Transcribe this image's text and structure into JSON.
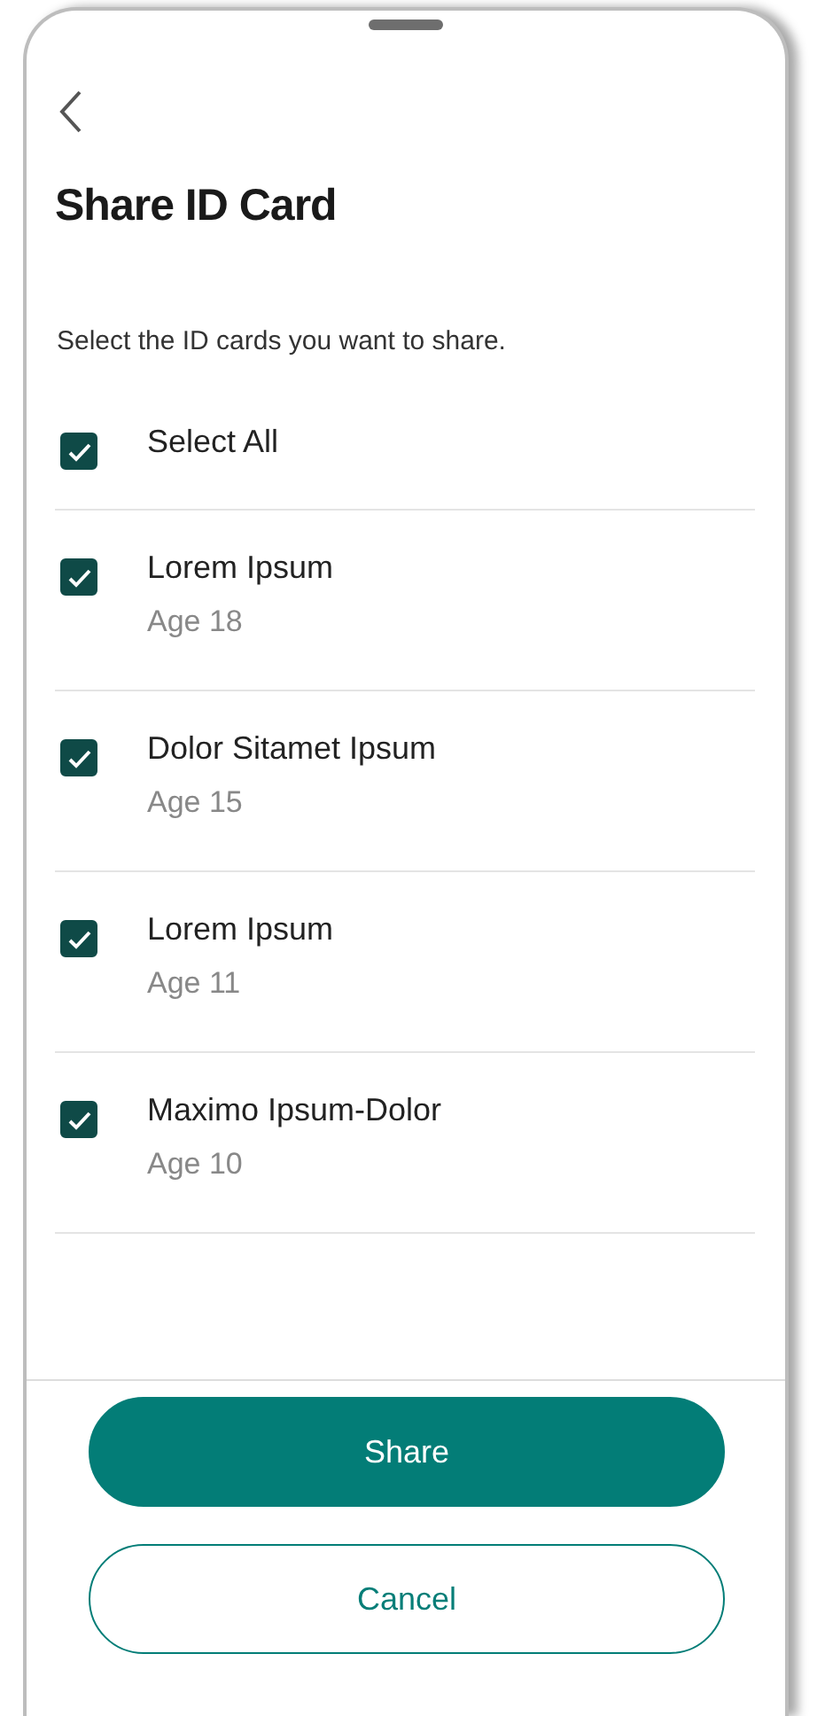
{
  "title": "Share ID Card",
  "instructions": "Select the ID cards you want to share.",
  "select_all": {
    "label": "Select All",
    "checked": true
  },
  "cards": [
    {
      "name": "Lorem Ipsum",
      "age": "Age 18",
      "checked": true
    },
    {
      "name": "Dolor Sitamet Ipsum",
      "age": "Age 15",
      "checked": true
    },
    {
      "name": "Lorem Ipsum",
      "age": "Age 11",
      "checked": true
    },
    {
      "name": "Maximo Ipsum-Dolor",
      "age": "Age 10",
      "checked": true
    }
  ],
  "buttons": [
    {
      "label": "Share",
      "kind": "primary"
    },
    {
      "label": "Cancel",
      "kind": "secondary"
    }
  ]
}
